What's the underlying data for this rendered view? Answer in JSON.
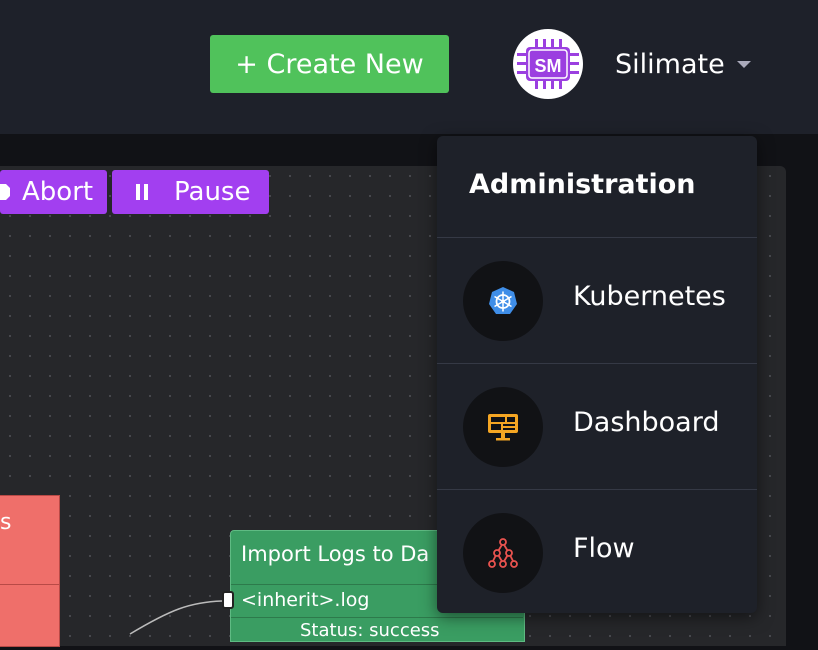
{
  "topbar": {
    "create_label": "+ Create New",
    "avatar_text": "SM",
    "user_name": "Silimate"
  },
  "canvas": {
    "abort_label": "Abort",
    "pause_label": "Pause",
    "red_node_label": "s",
    "green_node": {
      "title": "Import Logs to Da",
      "port_label": "<inherit>.log",
      "status_label": "Status: success"
    }
  },
  "dropdown": {
    "header": "Administration",
    "items": [
      {
        "label": "Kubernetes",
        "icon": "kubernetes-icon",
        "color": "#3f8ee8"
      },
      {
        "label": "Dashboard",
        "icon": "dashboard-icon",
        "color": "#f5a623"
      },
      {
        "label": "Flow",
        "icon": "flow-icon",
        "color": "#e9534f"
      }
    ]
  },
  "colors": {
    "brand_green": "#50c25b",
    "accent_purple": "#a23ff0",
    "node_red": "#ef6f6a",
    "node_green": "#3a9d62"
  }
}
